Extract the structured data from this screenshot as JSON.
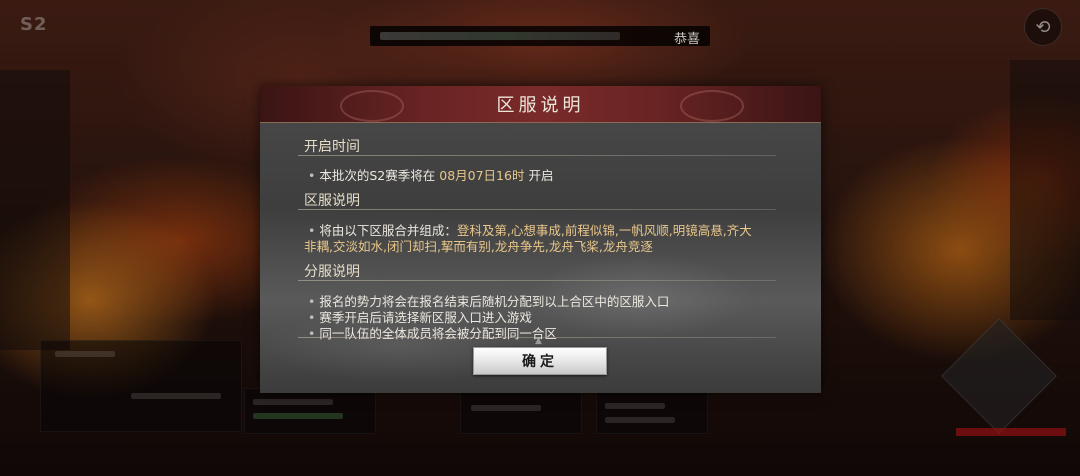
{
  "background": {
    "season_tag": "S2",
    "marquee_text": "恭喜",
    "back_icon": "back-arrow-icon"
  },
  "dialog": {
    "title": "区服说明",
    "sections": [
      {
        "heading": "开启时间",
        "lines": [
          {
            "prefix": "本批次的S2赛季将在 ",
            "highlight": "08月07日16时",
            "suffix": " 开启"
          }
        ]
      },
      {
        "heading": "区服说明",
        "lines": [
          {
            "prefix": "将由以下区服合并组成：",
            "highlight": "登科及第,心想事成,前程似锦,一帆风顺,明镜高悬,齐大"
          }
        ],
        "continuation": "非耦,交淡如水,闭门却扫,挈而有别,龙舟争先,龙舟飞桨,龙舟竞逐"
      },
      {
        "heading": "分服说明",
        "lines": [
          {
            "text": "报名的势力将会在报名结束后随机分配到以上合区中的区服入口"
          },
          {
            "text": "赛季开启后请选择新区服入口进入游戏"
          },
          {
            "text": "同一队伍的全体成员将会被分配到同一合区"
          }
        ]
      }
    ],
    "bullet_char": "•",
    "scroll_hint_char": "▲",
    "confirm_label": "确定"
  },
  "colors": {
    "header_red": "#6a2424",
    "highlight_gold": "#e9c78a",
    "panel_gray": "#4a4a4a"
  }
}
